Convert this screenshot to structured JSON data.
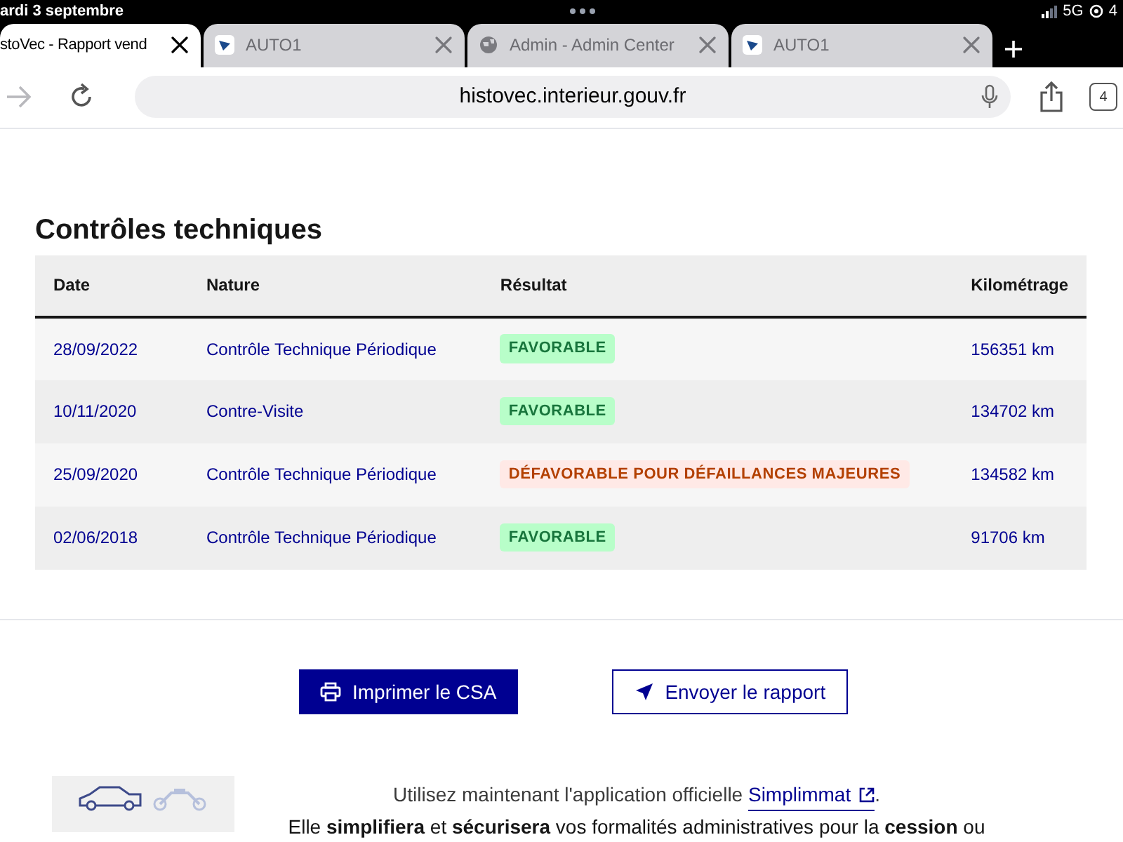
{
  "status_bar": {
    "date": "ardi 3 septembre",
    "network": "5G",
    "battery": "4"
  },
  "tabs": [
    {
      "title": "stoVec - Rapport vend",
      "kind": "none",
      "selected": true
    },
    {
      "title": "AUTO1",
      "kind": "logo",
      "selected": false
    },
    {
      "title": "Admin - Admin Center",
      "kind": "globe",
      "selected": false
    },
    {
      "title": "AUTO1",
      "kind": "logo",
      "selected": false
    }
  ],
  "address_bar": {
    "url": "histovec.interieur.gouv.fr",
    "tab_count": "4"
  },
  "section": {
    "title": "Contrôles techniques",
    "table": {
      "columns": [
        "Date",
        "Nature",
        "Résultat",
        "Kilométrage"
      ],
      "rows": [
        {
          "date": "28/09/2022",
          "nature": "Contrôle Technique Périodique",
          "result": "FAVORABLE",
          "kind": "favorable",
          "km": "156351 km"
        },
        {
          "date": "10/11/2020",
          "nature": "Contre-Visite",
          "result": "FAVORABLE",
          "kind": "favorable",
          "km": "134702 km"
        },
        {
          "date": "25/09/2020",
          "nature": "Contrôle Technique Périodique",
          "result": "DÉFAVORABLE POUR DÉFAILLANCES MAJEURES",
          "kind": "defavorable",
          "km": "134582 km"
        },
        {
          "date": "02/06/2018",
          "nature": "Contrôle Technique Périodique",
          "result": "FAVORABLE",
          "kind": "favorable",
          "km": "91706 km"
        }
      ]
    }
  },
  "buttons": [
    {
      "label": "Imprimer le CSA",
      "kind": "primary"
    },
    {
      "label": "Envoyer le rapport",
      "kind": "secondary"
    }
  ],
  "promo": {
    "text": "Utilisez maintenant l'application officielle",
    "link": "Simplimmat",
    "after": ".",
    "line2": "Elle **simplifiera** et **sécurisera** vos formalités administratives pour la **cession** ou"
  }
}
